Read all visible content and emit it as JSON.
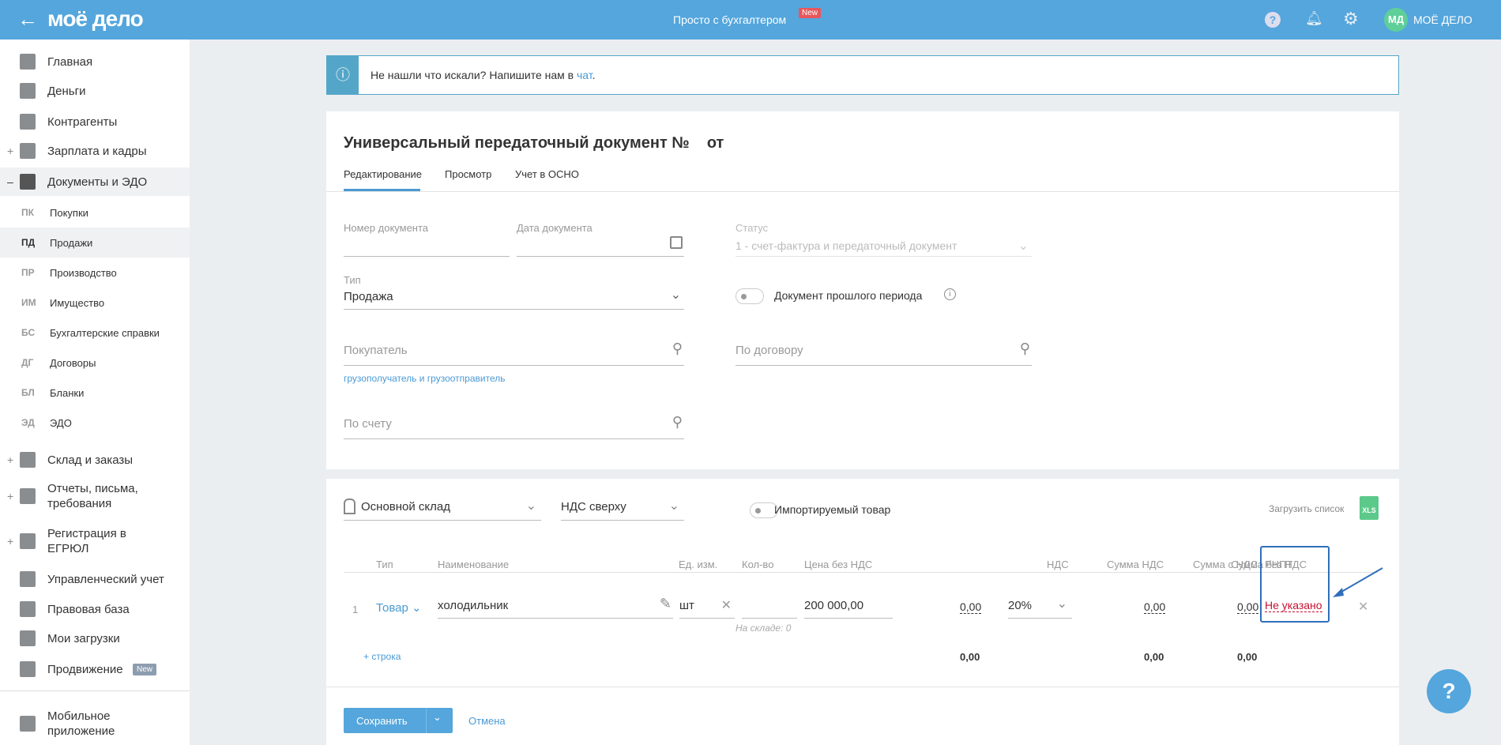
{
  "header": {
    "logo": "моё дело",
    "center": "Просто с бухгалтером",
    "new_badge": "New",
    "avatar": "МД",
    "company": "МОЁ ДЕЛО"
  },
  "sidebar": {
    "items": [
      {
        "label": "Главная",
        "icon": "home-icon"
      },
      {
        "label": "Деньги",
        "icon": "money-icon"
      },
      {
        "label": "Контрагенты",
        "icon": "contractors-icon"
      },
      {
        "label": "Зарплата и кадры",
        "icon": "salary-icon",
        "expand": "+"
      },
      {
        "label": "Документы и ЭДО",
        "icon": "folder-icon",
        "expand": "–"
      }
    ],
    "subitems": [
      {
        "abbr": "ПК",
        "label": "Покупки"
      },
      {
        "abbr": "ПД",
        "label": "Продажи"
      },
      {
        "abbr": "ПР",
        "label": "Производство"
      },
      {
        "abbr": "ИМ",
        "label": "Имущество"
      },
      {
        "abbr": "БС",
        "label": "Бухгалтерские справки"
      },
      {
        "abbr": "ДГ",
        "label": "Договоры"
      },
      {
        "abbr": "БЛ",
        "label": "Бланки"
      },
      {
        "abbr": "ЭД",
        "label": "ЭДО"
      }
    ],
    "items2": [
      {
        "label": "Склад и заказы",
        "expand": "+"
      },
      {
        "label": "Отчеты, письма, требования",
        "expand": "+"
      },
      {
        "label": "Регистрация в ЕГРЮЛ",
        "expand": "+"
      },
      {
        "label": "Управленческий учет"
      },
      {
        "label": "Правовая база"
      },
      {
        "label": "Мои загрузки"
      },
      {
        "label": "Продвижение",
        "badge": "New"
      }
    ],
    "mobile": "Мобильное приложение"
  },
  "banner": {
    "text": "Не нашли что искали? Напишите нам в ",
    "link": "чат",
    "end": "."
  },
  "doc": {
    "title": "Универсальный передаточный документ №    от",
    "tabs": [
      "Редактирование",
      "Просмотр",
      "Учет в ОСНО"
    ],
    "number_label": "Номер документа",
    "date_label": "Дата документа",
    "status_label": "Статус",
    "status_value": "1 - счет-фактура и передаточный документ",
    "type_label": "Тип",
    "type_value": "Продажа",
    "past_period": "Документ прошлого периода",
    "buyer_placeholder": "Покупатель",
    "consignee_link": "грузополучатель и грузоотправитель",
    "contract_placeholder": "По договору",
    "invoice_placeholder": "По счету"
  },
  "goods": {
    "warehouse": "Основной склад",
    "vat_mode": "НДС сверху",
    "imported": "Импортируемый товар",
    "upload": "Загрузить список",
    "xls": "XLS",
    "columns": [
      "Тип",
      "Наименование",
      "Ед. изм.",
      "Кол-во",
      "Цена без НДС",
      "Сумма без НДС",
      "НДС",
      "Сумма НДС",
      "Сумма с НДС",
      "РНПТ"
    ],
    "row": {
      "num": "1",
      "type": "Товар",
      "name": "холодильник",
      "unit": "шт",
      "qty": "",
      "stock": "На складе: 0",
      "price": "200 000,00",
      "sum_no_vat": "0,00",
      "vat": "20%",
      "vat_sum": "0,00",
      "sum_vat": "0,00",
      "rnpt": "Не указано"
    },
    "add_row": "строка",
    "totals": {
      "sum_no_vat": "0,00",
      "vat_sum": "0,00",
      "sum_vat": "0,00"
    }
  },
  "footer": {
    "save": "Сохранить",
    "cancel": "Отмена"
  },
  "colors": {
    "header": "#54a6dc",
    "accent": "#4a9ad5",
    "error": "#c8102e",
    "highlight": "#2f6fba"
  }
}
